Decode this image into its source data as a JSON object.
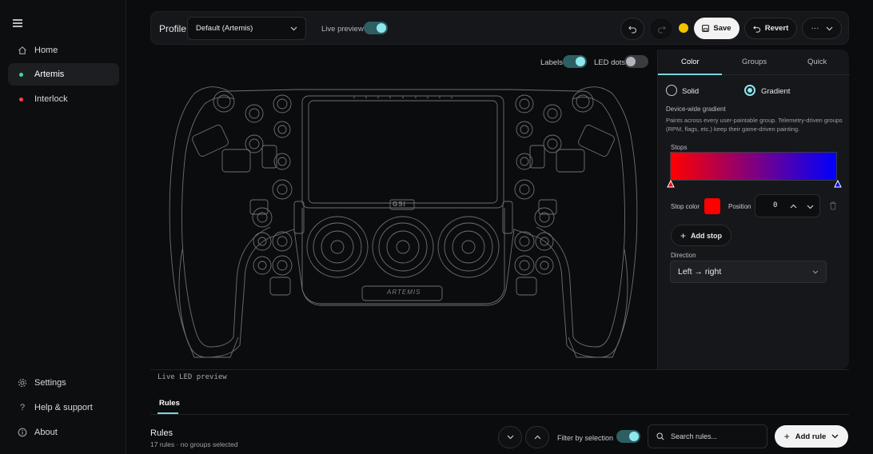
{
  "sidebar": {
    "items": [
      {
        "label": "Home",
        "icon": "home-icon"
      },
      {
        "label": "Artemis",
        "status_color": "#3ddc97",
        "active": true
      },
      {
        "label": "Interlock",
        "status_color": "#ff3b4a"
      }
    ],
    "footer": [
      {
        "label": "Settings",
        "icon": "gear-icon"
      },
      {
        "label": "Help & support",
        "icon": "help-icon"
      },
      {
        "label": "About",
        "icon": "info-icon"
      }
    ]
  },
  "topbar": {
    "profile_label": "Profile",
    "profile_value": "Default (Artemis)",
    "live_preview_label": "Live preview",
    "live_preview_on": true,
    "save_label": "Save",
    "revert_label": "Revert",
    "more_label": "···",
    "unsaved_indicator_color": "#f2c400"
  },
  "preview": {
    "labels_toggle_label": "Labels",
    "labels_on": true,
    "led_dots_label": "LED dots",
    "led_dots_on": false,
    "caption": "Live LED preview",
    "wheel_logo_text": "ARTEMIS",
    "wheel_brand_text": "GSI"
  },
  "panel": {
    "tabs": [
      "Color",
      "Groups",
      "Quick"
    ],
    "active_tab": "Color",
    "mode_solid": "Solid",
    "mode_gradient": "Gradient",
    "selected_mode": "Gradient",
    "desc_title": "Device-wide gradient",
    "desc_body": "Paints across every user-paintable group. Telemetry-driven groups (RPM, flags, etc.) keep their game-driven painting.",
    "stops_label": "Stops",
    "gradient_colors": [
      "#ff0000",
      "#0000ff"
    ],
    "stop_color_label": "Stop color",
    "stop_color": "#ff0000",
    "position_label": "Position",
    "position_value": "0",
    "add_stop_label": "Add stop",
    "direction_label": "Direction",
    "direction_value": "Left → right"
  },
  "bottom": {
    "tab_label": "Rules",
    "rules_title": "Rules",
    "rules_sub": "17 rules · no groups selected",
    "filter_label": "Filter by selection",
    "filter_on": true,
    "search_placeholder": "Search rules...",
    "add_rule_label": "Add rule"
  }
}
